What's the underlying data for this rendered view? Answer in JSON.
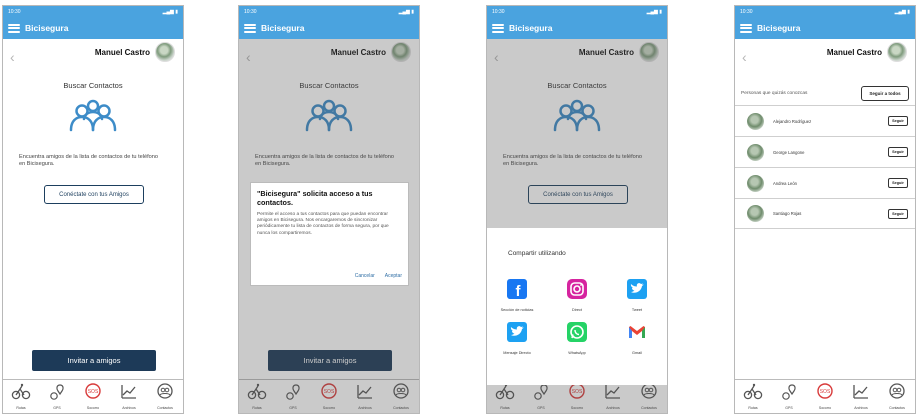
{
  "app_title": "Bicisegura",
  "user_name": "Manuel Castro",
  "status_time": "10:30",
  "screen_title": "Buscar Contactos",
  "description": "Encuentra amigos de la lista de contactos de tu teléfono en Bicisegura.",
  "connect_label": "Conéctate con tus Amigos",
  "invite_label": "Invitar a amigos",
  "dialog": {
    "title": "\"Bicisegura\" solicita acceso a tus contactos.",
    "body": "Permite el acceso a tus contactos para que puedan encontrar amigos en Bicisegura. Nos encargaremos de sincronizar periódicamente tu lista de contactos de forma segura, por que nunca los compartiremos.",
    "cancel": "Cancelar",
    "accept": "Aceptar"
  },
  "share": {
    "title": "Compartir utilizando",
    "items": [
      {
        "label": "Sección de noticias",
        "icon": "facebook-icon",
        "color": "#1877f2"
      },
      {
        "label": "Direct",
        "icon": "instagram-icon",
        "color": "#d6249f"
      },
      {
        "label": "Tweet",
        "icon": "twitter-icon",
        "color": "#1da1f2"
      },
      {
        "label": "Mensaje Directo",
        "icon": "twitter-dm-icon",
        "color": "#1da1f2"
      },
      {
        "label": "WhatsApp",
        "icon": "whatsapp-icon",
        "color": "#25d366"
      },
      {
        "label": "Gmail",
        "icon": "gmail-icon",
        "color": "#ea4335"
      }
    ]
  },
  "follow": {
    "prompt": "Personas que quizás conozcas",
    "all_label": "Seguir a todos",
    "button_label": "Seguir",
    "contacts": [
      {
        "name": "Alejandro Rodríguez"
      },
      {
        "name": "George Langone"
      },
      {
        "name": "Andrea León"
      },
      {
        "name": "Santiago Rojas"
      }
    ]
  },
  "nav": [
    {
      "label": "Rutas",
      "icon": "cyclist-icon"
    },
    {
      "label": "GPS",
      "icon": "gps-icon"
    },
    {
      "label": "Socorro",
      "icon": "sos-icon"
    },
    {
      "label": "Archivos",
      "icon": "chart-icon"
    },
    {
      "label": "Contactos",
      "icon": "contacts-icon"
    }
  ],
  "colors": {
    "primary": "#4aa3df",
    "dark_button": "#1d3a58",
    "sos": "#d83a3a"
  }
}
